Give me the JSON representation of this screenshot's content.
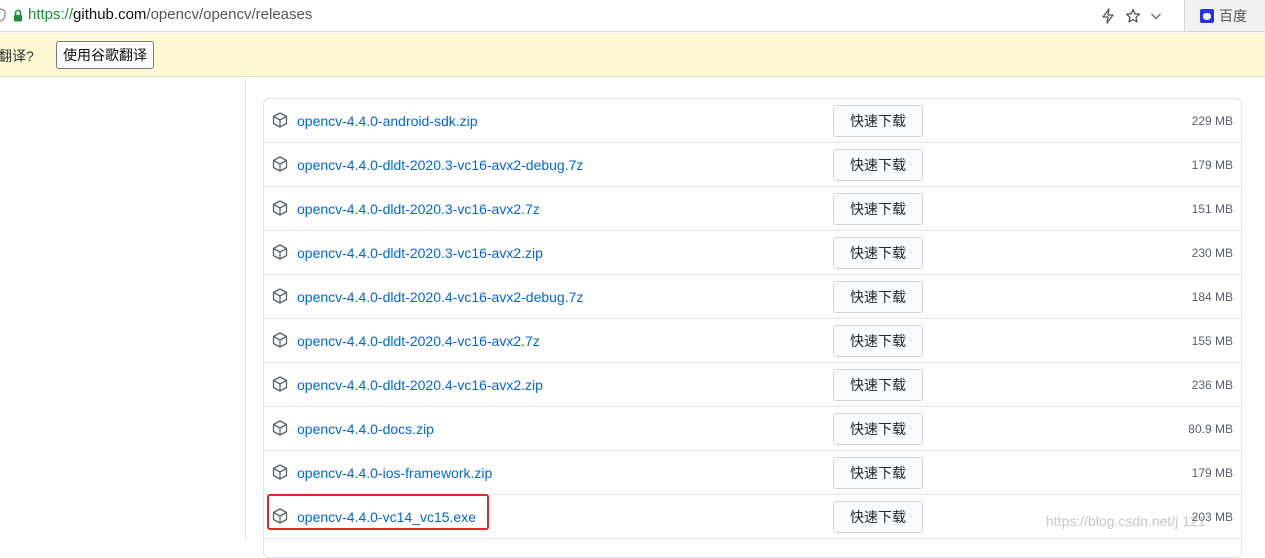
{
  "browser": {
    "url_scheme": "https://",
    "url_host": "github.com",
    "url_path": "/opencv/opencv/releases",
    "search_engine": "百度",
    "icons": [
      "shield-icon",
      "lock-icon",
      "bolt-icon",
      "star-icon",
      "chevron-down-icon",
      "baidu-icon"
    ]
  },
  "translate_bar": {
    "prompt": "翻译?",
    "button": "使用谷歌翻译"
  },
  "assets": {
    "download_label": "快速下载",
    "rows": [
      {
        "name": "opencv-4.4.0-android-sdk.zip",
        "size": "229 MB"
      },
      {
        "name": "opencv-4.4.0-dldt-2020.3-vc16-avx2-debug.7z",
        "size": "179 MB"
      },
      {
        "name": "opencv-4.4.0-dldt-2020.3-vc16-avx2.7z",
        "size": "151 MB"
      },
      {
        "name": "opencv-4.4.0-dldt-2020.3-vc16-avx2.zip",
        "size": "230 MB"
      },
      {
        "name": "opencv-4.4.0-dldt-2020.4-vc16-avx2-debug.7z",
        "size": "184 MB"
      },
      {
        "name": "opencv-4.4.0-dldt-2020.4-vc16-avx2.7z",
        "size": "155 MB"
      },
      {
        "name": "opencv-4.4.0-dldt-2020.4-vc16-avx2.zip",
        "size": "236 MB"
      },
      {
        "name": "opencv-4.4.0-docs.zip",
        "size": "80.9 MB"
      },
      {
        "name": "opencv-4.4.0-ios-framework.zip",
        "size": "179 MB"
      },
      {
        "name": "opencv-4.4.0-vc14_vc15.exe",
        "size": "203 MB"
      }
    ]
  },
  "watermark": "https://blog.csdn.net/j    121",
  "colors": {
    "link": "#0366d6",
    "highlight": "#e0282b",
    "translate_bar_bg": "#fdf7d4",
    "url_scheme": "#1a8f3c"
  }
}
